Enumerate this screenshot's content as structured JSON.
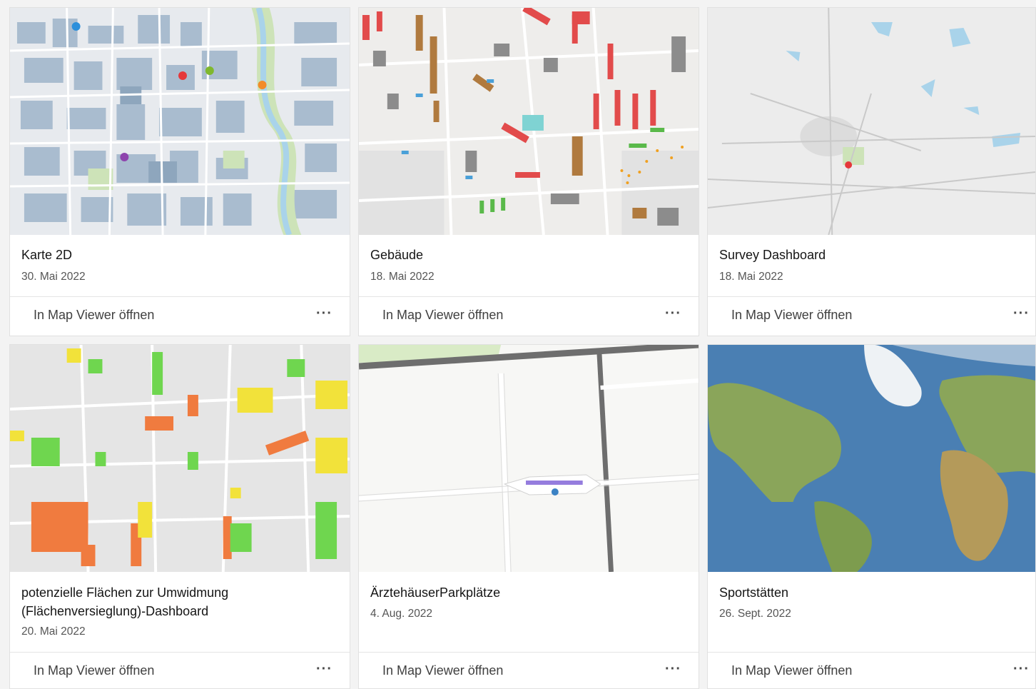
{
  "cards": [
    {
      "title": "Karte 2D",
      "date": "30. Mai 2022",
      "open_label": "In Map Viewer öffnen",
      "more_label": "···",
      "thumbnail": "city-map-with-points"
    },
    {
      "title": "Gebäude",
      "date": "18. Mai 2022",
      "open_label": "In Map Viewer öffnen",
      "more_label": "···",
      "thumbnail": "building-footprints-map"
    },
    {
      "title": "Survey Dashboard",
      "date": "18. Mai 2022",
      "open_label": "In Map Viewer öffnen",
      "more_label": "···",
      "thumbnail": "regional-map"
    },
    {
      "title": "potenzielle Flächen zur Umwidmung (Flächenversieglung)-Dashboard",
      "date": "20. Mai 2022",
      "open_label": "In Map Viewer öffnen",
      "more_label": "···",
      "thumbnail": "land-use-map"
    },
    {
      "title": "ÄrztehäuserParkplätze",
      "date": "4. Aug. 2022",
      "open_label": "In Map Viewer öffnen",
      "more_label": "···",
      "thumbnail": "street-map-detail"
    },
    {
      "title": "Sportstätten",
      "date": "26. Sept. 2022",
      "open_label": "In Map Viewer öffnen",
      "more_label": "···",
      "thumbnail": "world-imagery-map"
    }
  ],
  "colors": {
    "map_street_bg": "#e9ecef",
    "map_block": "#9fb3c8",
    "map_green": "#cde3b8",
    "map_water": "#a9d3ea",
    "building_red": "#e24b4b",
    "building_brown": "#b07a3e",
    "land_orange": "#f07b3f",
    "land_yellow": "#f2e23a",
    "land_green": "#6fd64f",
    "ocean": "#4a7fb3",
    "land": "#8aa55a"
  }
}
